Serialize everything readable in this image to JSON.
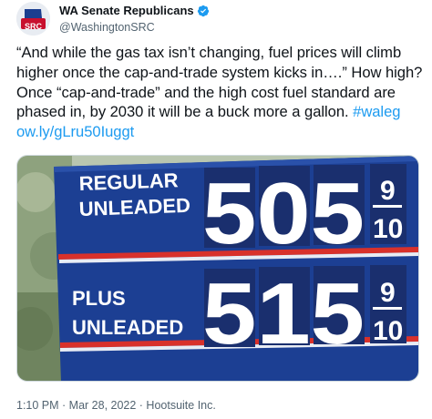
{
  "account": {
    "display_name": "WA Senate Republicans",
    "handle": "@WashingtonSRC",
    "avatar_text": "SRC",
    "verified": true
  },
  "tweet": {
    "text_before": "“And while the gas tax isn’t changing, fuel prices will climb higher once the cap-and-trade system kicks in….” How high? Once “cap-and-trade” and the high cost fuel standard are phased in, by 2030 it will be a buck more a gallon. ",
    "hashtag": "#waleg",
    "link": "ow.ly/gLru50Iuggt"
  },
  "image": {
    "regular_line1": "REGULAR",
    "regular_line2": "UNLEADED",
    "regular_price": "505",
    "regular_tenths_num": "9",
    "regular_tenths_den": "10",
    "plus_line1": "PLUS",
    "plus_line2": "UNLEADED",
    "plus_price": "515",
    "plus_tenths_num": "9",
    "plus_tenths_den": "10"
  },
  "meta": {
    "timestamp": "1:10 PM · Mar 28, 2022 · Hootsuite Inc."
  },
  "colors": {
    "sign_blue": "#1c3f93",
    "link_blue": "#1d9bf0",
    "stripe_red": "#d8312b"
  }
}
